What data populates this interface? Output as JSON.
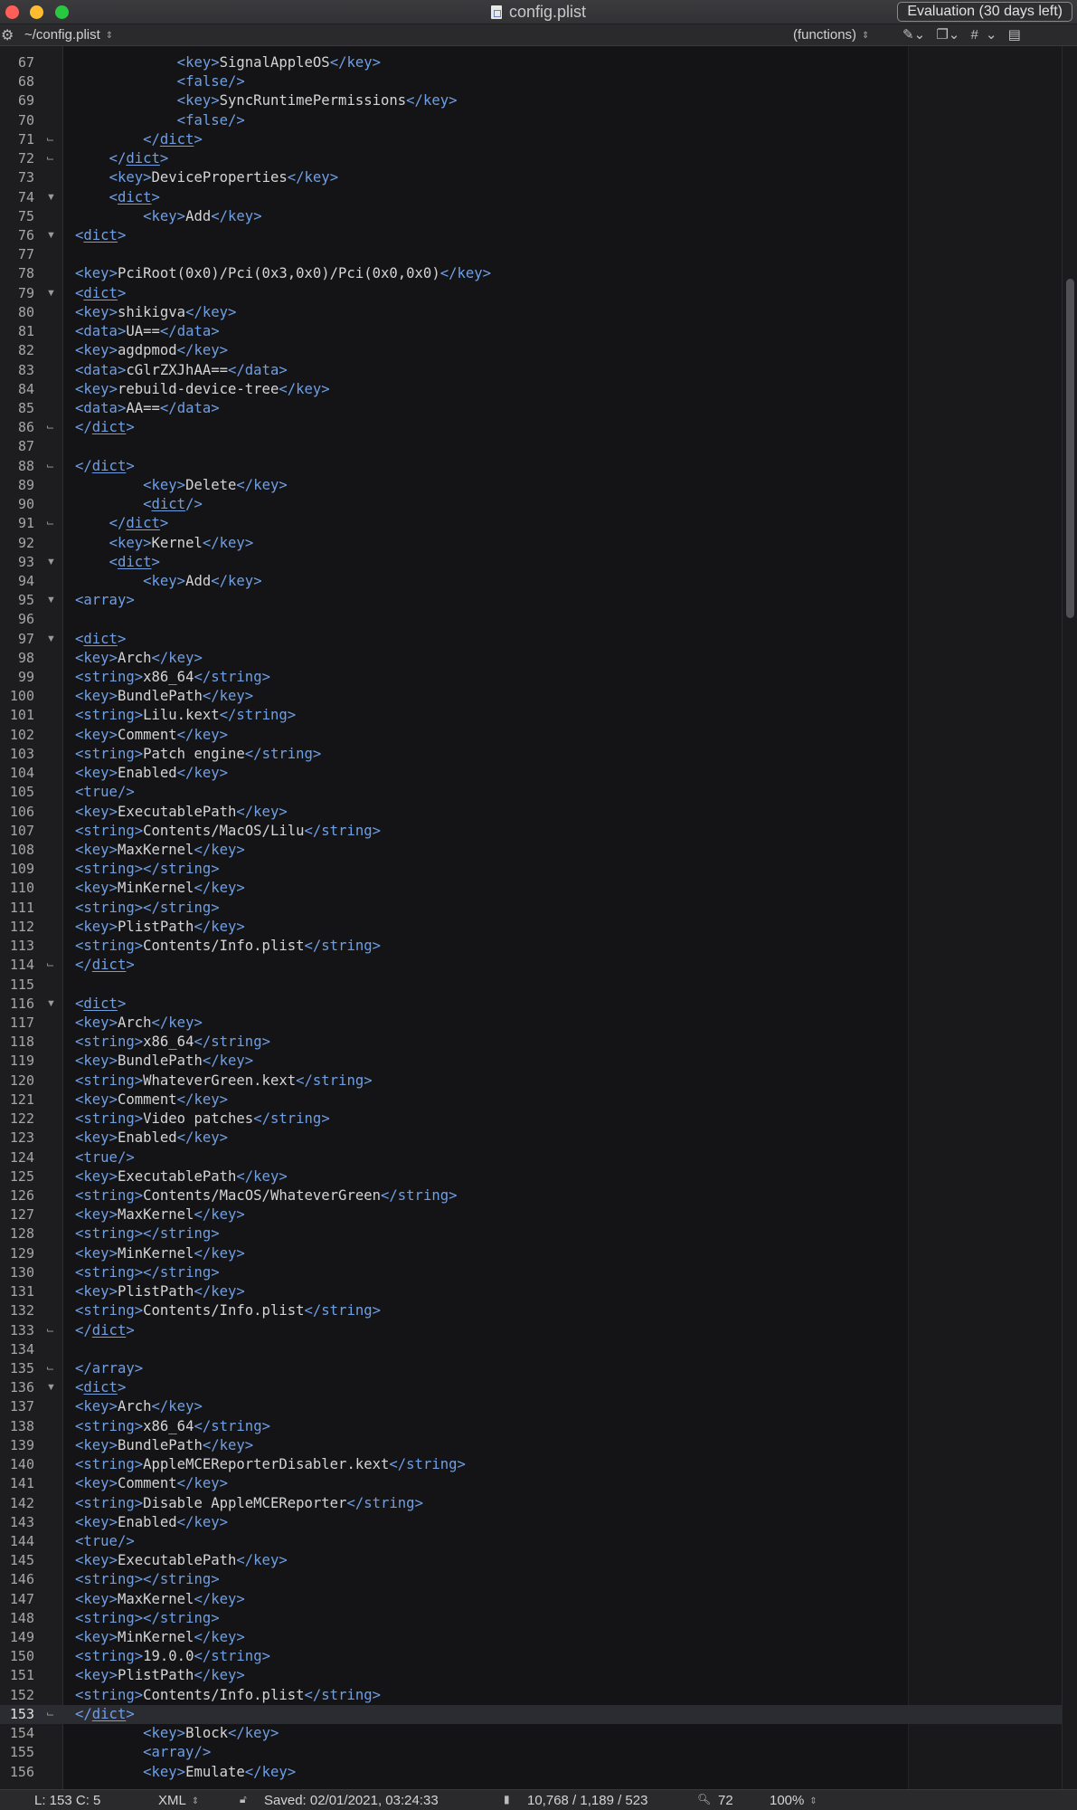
{
  "window": {
    "title": "config.plist",
    "evaluation_label": "Evaluation (30 days left)"
  },
  "navbar": {
    "file_path": "~/config.plist",
    "function_menu": "(functions)",
    "marker_label": "#"
  },
  "editor": {
    "current_line": 153,
    "lines": [
      {
        "n": "67",
        "fold": "",
        "code": "            <key>SignalAppleOS</key>"
      },
      {
        "n": "68",
        "fold": "",
        "code": "            <false/>"
      },
      {
        "n": "69",
        "fold": "",
        "code": "            <key>SyncRuntimePermissions</key>"
      },
      {
        "n": "70",
        "fold": "",
        "code": "            <false/>"
      },
      {
        "n": "71",
        "fold": "end",
        "code": "        </dict>"
      },
      {
        "n": "72",
        "fold": "end",
        "code": "    </dict>"
      },
      {
        "n": "73",
        "fold": "",
        "code": "    <key>DeviceProperties</key>"
      },
      {
        "n": "74",
        "fold": "open",
        "code": "    <dict>"
      },
      {
        "n": "75",
        "fold": "",
        "code": "        <key>Add</key>"
      },
      {
        "n": "76",
        "fold": "open",
        "code": "<dict>"
      },
      {
        "n": "77",
        "fold": "",
        "code": ""
      },
      {
        "n": "78",
        "fold": "",
        "code": "<key>PciRoot(0x0)/Pci(0x3,0x0)/Pci(0x0,0x0)</key>"
      },
      {
        "n": "79",
        "fold": "open",
        "code": "<dict>"
      },
      {
        "n": "80",
        "fold": "",
        "code": "<key>shikigva</key>"
      },
      {
        "n": "81",
        "fold": "",
        "code": "<data>UA==</data>"
      },
      {
        "n": "82",
        "fold": "",
        "code": "<key>agdpmod</key>"
      },
      {
        "n": "83",
        "fold": "",
        "code": "<data>cGlrZXJhAA==</data>"
      },
      {
        "n": "84",
        "fold": "",
        "code": "<key>rebuild-device-tree</key>"
      },
      {
        "n": "85",
        "fold": "",
        "code": "<data>AA==</data>"
      },
      {
        "n": "86",
        "fold": "end",
        "code": "</dict>"
      },
      {
        "n": "87",
        "fold": "",
        "code": ""
      },
      {
        "n": "88",
        "fold": "end",
        "code": "</dict>"
      },
      {
        "n": "89",
        "fold": "",
        "code": "        <key>Delete</key>"
      },
      {
        "n": "90",
        "fold": "",
        "code": "        <dict/>"
      },
      {
        "n": "91",
        "fold": "end",
        "code": "    </dict>"
      },
      {
        "n": "92",
        "fold": "",
        "code": "    <key>Kernel</key>"
      },
      {
        "n": "93",
        "fold": "open",
        "code": "    <dict>"
      },
      {
        "n": "94",
        "fold": "",
        "code": "        <key>Add</key>"
      },
      {
        "n": "95",
        "fold": "open",
        "code": "<array>"
      },
      {
        "n": "96",
        "fold": "",
        "code": ""
      },
      {
        "n": "97",
        "fold": "open",
        "code": "<dict>"
      },
      {
        "n": "98",
        "fold": "",
        "code": "<key>Arch</key>"
      },
      {
        "n": "99",
        "fold": "",
        "code": "<string>x86_64</string>"
      },
      {
        "n": "100",
        "fold": "",
        "code": "<key>BundlePath</key>"
      },
      {
        "n": "101",
        "fold": "",
        "code": "<string>Lilu.kext</string>"
      },
      {
        "n": "102",
        "fold": "",
        "code": "<key>Comment</key>"
      },
      {
        "n": "103",
        "fold": "",
        "code": "<string>Patch engine</string>"
      },
      {
        "n": "104",
        "fold": "",
        "code": "<key>Enabled</key>"
      },
      {
        "n": "105",
        "fold": "",
        "code": "<true/>"
      },
      {
        "n": "106",
        "fold": "",
        "code": "<key>ExecutablePath</key>"
      },
      {
        "n": "107",
        "fold": "",
        "code": "<string>Contents/MacOS/Lilu</string>"
      },
      {
        "n": "108",
        "fold": "",
        "code": "<key>MaxKernel</key>"
      },
      {
        "n": "109",
        "fold": "",
        "code": "<string></string>"
      },
      {
        "n": "110",
        "fold": "",
        "code": "<key>MinKernel</key>"
      },
      {
        "n": "111",
        "fold": "",
        "code": "<string></string>"
      },
      {
        "n": "112",
        "fold": "",
        "code": "<key>PlistPath</key>"
      },
      {
        "n": "113",
        "fold": "",
        "code": "<string>Contents/Info.plist</string>"
      },
      {
        "n": "114",
        "fold": "end",
        "code": "</dict>"
      },
      {
        "n": "115",
        "fold": "",
        "code": ""
      },
      {
        "n": "116",
        "fold": "open",
        "code": "<dict>"
      },
      {
        "n": "117",
        "fold": "",
        "code": "<key>Arch</key>"
      },
      {
        "n": "118",
        "fold": "",
        "code": "<string>x86_64</string>"
      },
      {
        "n": "119",
        "fold": "",
        "code": "<key>BundlePath</key>"
      },
      {
        "n": "120",
        "fold": "",
        "code": "<string>WhateverGreen.kext</string>"
      },
      {
        "n": "121",
        "fold": "",
        "code": "<key>Comment</key>"
      },
      {
        "n": "122",
        "fold": "",
        "code": "<string>Video patches</string>"
      },
      {
        "n": "123",
        "fold": "",
        "code": "<key>Enabled</key>"
      },
      {
        "n": "124",
        "fold": "",
        "code": "<true/>"
      },
      {
        "n": "125",
        "fold": "",
        "code": "<key>ExecutablePath</key>"
      },
      {
        "n": "126",
        "fold": "",
        "code": "<string>Contents/MacOS/WhateverGreen</string>"
      },
      {
        "n": "127",
        "fold": "",
        "code": "<key>MaxKernel</key>"
      },
      {
        "n": "128",
        "fold": "",
        "code": "<string></string>"
      },
      {
        "n": "129",
        "fold": "",
        "code": "<key>MinKernel</key>"
      },
      {
        "n": "130",
        "fold": "",
        "code": "<string></string>"
      },
      {
        "n": "131",
        "fold": "",
        "code": "<key>PlistPath</key>"
      },
      {
        "n": "132",
        "fold": "",
        "code": "<string>Contents/Info.plist</string>"
      },
      {
        "n": "133",
        "fold": "end",
        "code": "</dict>"
      },
      {
        "n": "134",
        "fold": "",
        "code": ""
      },
      {
        "n": "135",
        "fold": "end",
        "code": "</array>"
      },
      {
        "n": "136",
        "fold": "open",
        "code": "<dict>"
      },
      {
        "n": "137",
        "fold": "",
        "code": "<key>Arch</key>"
      },
      {
        "n": "138",
        "fold": "",
        "code": "<string>x86_64</string>"
      },
      {
        "n": "139",
        "fold": "",
        "code": "<key>BundlePath</key>"
      },
      {
        "n": "140",
        "fold": "",
        "code": "<string>AppleMCEReporterDisabler.kext</string>"
      },
      {
        "n": "141",
        "fold": "",
        "code": "<key>Comment</key>"
      },
      {
        "n": "142",
        "fold": "",
        "code": "<string>Disable AppleMCEReporter</string>"
      },
      {
        "n": "143",
        "fold": "",
        "code": "<key>Enabled</key>"
      },
      {
        "n": "144",
        "fold": "",
        "code": "<true/>"
      },
      {
        "n": "145",
        "fold": "",
        "code": "<key>ExecutablePath</key>"
      },
      {
        "n": "146",
        "fold": "",
        "code": "<string></string>"
      },
      {
        "n": "147",
        "fold": "",
        "code": "<key>MaxKernel</key>"
      },
      {
        "n": "148",
        "fold": "",
        "code": "<string></string>"
      },
      {
        "n": "149",
        "fold": "",
        "code": "<key>MinKernel</key>"
      },
      {
        "n": "150",
        "fold": "",
        "code": "<string>19.0.0</string>"
      },
      {
        "n": "151",
        "fold": "",
        "code": "<key>PlistPath</key>"
      },
      {
        "n": "152",
        "fold": "",
        "code": "<string>Contents/Info.plist</string>"
      },
      {
        "n": "153",
        "fold": "end",
        "code": "</dict>"
      },
      {
        "n": "154",
        "fold": "",
        "code": "        <key>Block</key>"
      },
      {
        "n": "155",
        "fold": "",
        "code": "        <array/>"
      },
      {
        "n": "156",
        "fold": "",
        "code": "        <key>Emulate</key>"
      }
    ]
  },
  "statusbar": {
    "cursor_position": "L: 153 C: 5",
    "syntax": "XML",
    "saved": "Saved: 02/01/2021, 03:24:33",
    "document_stats": "10,768 / 1,189 / 523",
    "search_count": "72",
    "zoom": "100%"
  },
  "colors": {
    "tag": "#6f9fe3",
    "text": "#d4d4d4",
    "background": "#141417",
    "current_line": "#2b2b32"
  }
}
